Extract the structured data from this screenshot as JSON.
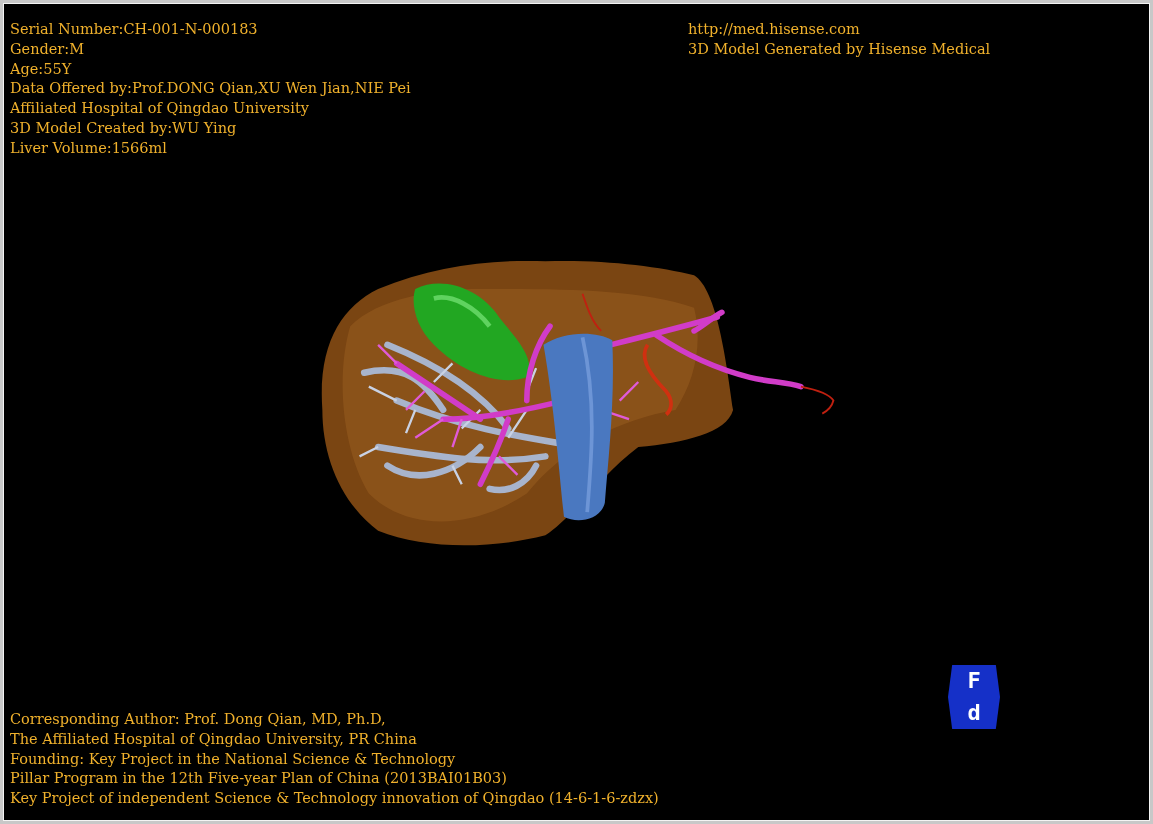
{
  "patient_info": [
    "Serial Number:CH-001-N-000183",
    "Gender:M",
    "Age:55Y",
    "Data Offered by:Prof.DONG Qian,XU Wen Jian,NIE Pei",
    "Affiliated Hospital of Qingdao University",
    "3D Model Created by:WU Ying",
    "Liver Volume:1566ml"
  ],
  "credits": [
    "http://med.hisense.com",
    "3D Model Generated by Hisense Medical"
  ],
  "footer": [
    "Corresponding Author: Prof. Dong Qian, MD, Ph.D,",
    "The Affiliated Hospital of Qingdao University, PR China",
    "Founding: Key Project in the National Science & Technology",
    "Pillar Program in the 12th Five-year Plan of China (2013BAI01B03)",
    "Key Project of independent Science & Technology innovation of Qingdao (14-6-1-6-zdzx)"
  ],
  "orientation_cube": {
    "faces": [
      "F",
      "d"
    ]
  }
}
